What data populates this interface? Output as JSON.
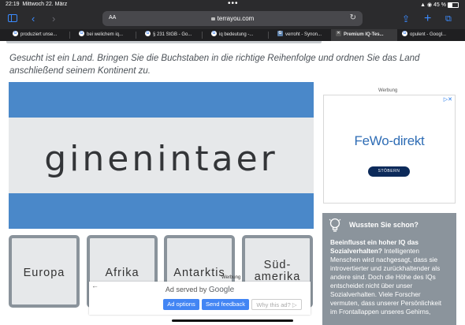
{
  "status_bar": {
    "time": "22:19",
    "date": "Mittwoch 22. März",
    "battery": "45 %"
  },
  "toolbar": {
    "aa_label": "AA",
    "url": "terrayou.com"
  },
  "tabs": [
    {
      "label": "produziert unse...",
      "icon": "google-favicon"
    },
    {
      "label": "bei welichem iq...",
      "icon": "google-favicon"
    },
    {
      "label": "§ 231 StGB - Go...",
      "icon": "google-favicon"
    },
    {
      "label": "iq bedeutung -...",
      "icon": "google-favicon"
    },
    {
      "label": "verroht - Synon...",
      "icon": "synonym-favicon"
    },
    {
      "label": "Premium IQ-Tes...",
      "icon": "close-icon",
      "active": true
    },
    {
      "label": "opulent - Googl...",
      "icon": "google-favicon"
    }
  ],
  "page": {
    "instruction": "Gesucht ist ein Land. Bringen Sie die Buchstaben in die richtige Reihenfolge und ordnen Sie das Land anschließend seinem Kontinent zu.",
    "scrambled_word": "ginenintaer",
    "continents": [
      "Europa",
      "Afrika",
      "Antarktis",
      "Süd-\namerika"
    ]
  },
  "ad_side": {
    "label": "Werbung",
    "choice": "▷✕",
    "brand": "FeWo-direkt",
    "cta": "STÖBERN"
  },
  "knowledge_box": {
    "title": "Wussten Sie schon?",
    "bold_text": "Beeinflusst ein hoher IQ das Sozialverhalten?",
    "text": " Intelligenten Menschen wird nachgesagt, dass sie introvertierter und zurückhaltender als andere sind. Doch die Höhe des IQs entscheidet nicht über unser Sozialverhalten. Viele Forscher vermuten, dass unserer Persönlichkeit im Frontallappen unseres Gehirns,"
  },
  "ad_overlay": {
    "werbung": "Werbung",
    "served_by": "Ad served by",
    "google": "Google",
    "ad_options": "Ad options",
    "send_feedback": "Send feedback",
    "why_this_ad": "Why this ad? ▷"
  },
  "colors": {
    "stripe_blue": "#4a88c9",
    "box_grey": "#8b949c",
    "safari_blue": "#3b8bff"
  }
}
